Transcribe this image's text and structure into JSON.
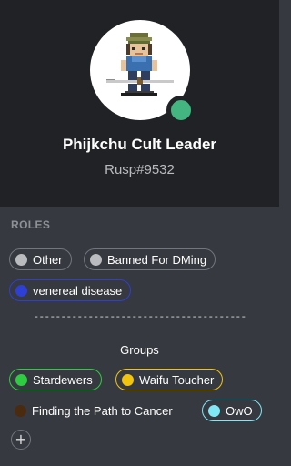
{
  "profile": {
    "username": "Phijkchu Cult Leader",
    "tag": "Rusp#9532",
    "status_color": "#43b581",
    "avatar_icon": "pixel-character-avatar"
  },
  "roles": {
    "title": "ROLES",
    "items": [
      {
        "label": "Other",
        "color": "#b9bbbe"
      },
      {
        "label": "Banned For DMing",
        "color": "#b9bbbe"
      },
      {
        "label": "venereal disease",
        "color": "#2e3fd6"
      }
    ]
  },
  "divider": "---------------------------------------",
  "groups": {
    "title": "Groups",
    "items": [
      {
        "label": "Stardewers",
        "color": "#2ecc40"
      },
      {
        "label": "Waifu Toucher",
        "color": "#f1c40f"
      },
      {
        "label": "Finding the Path to Cancer",
        "color": "#4a2b0f"
      },
      {
        "label": "OwO",
        "color": "#7ee8f4"
      }
    ]
  },
  "add_role": "+"
}
